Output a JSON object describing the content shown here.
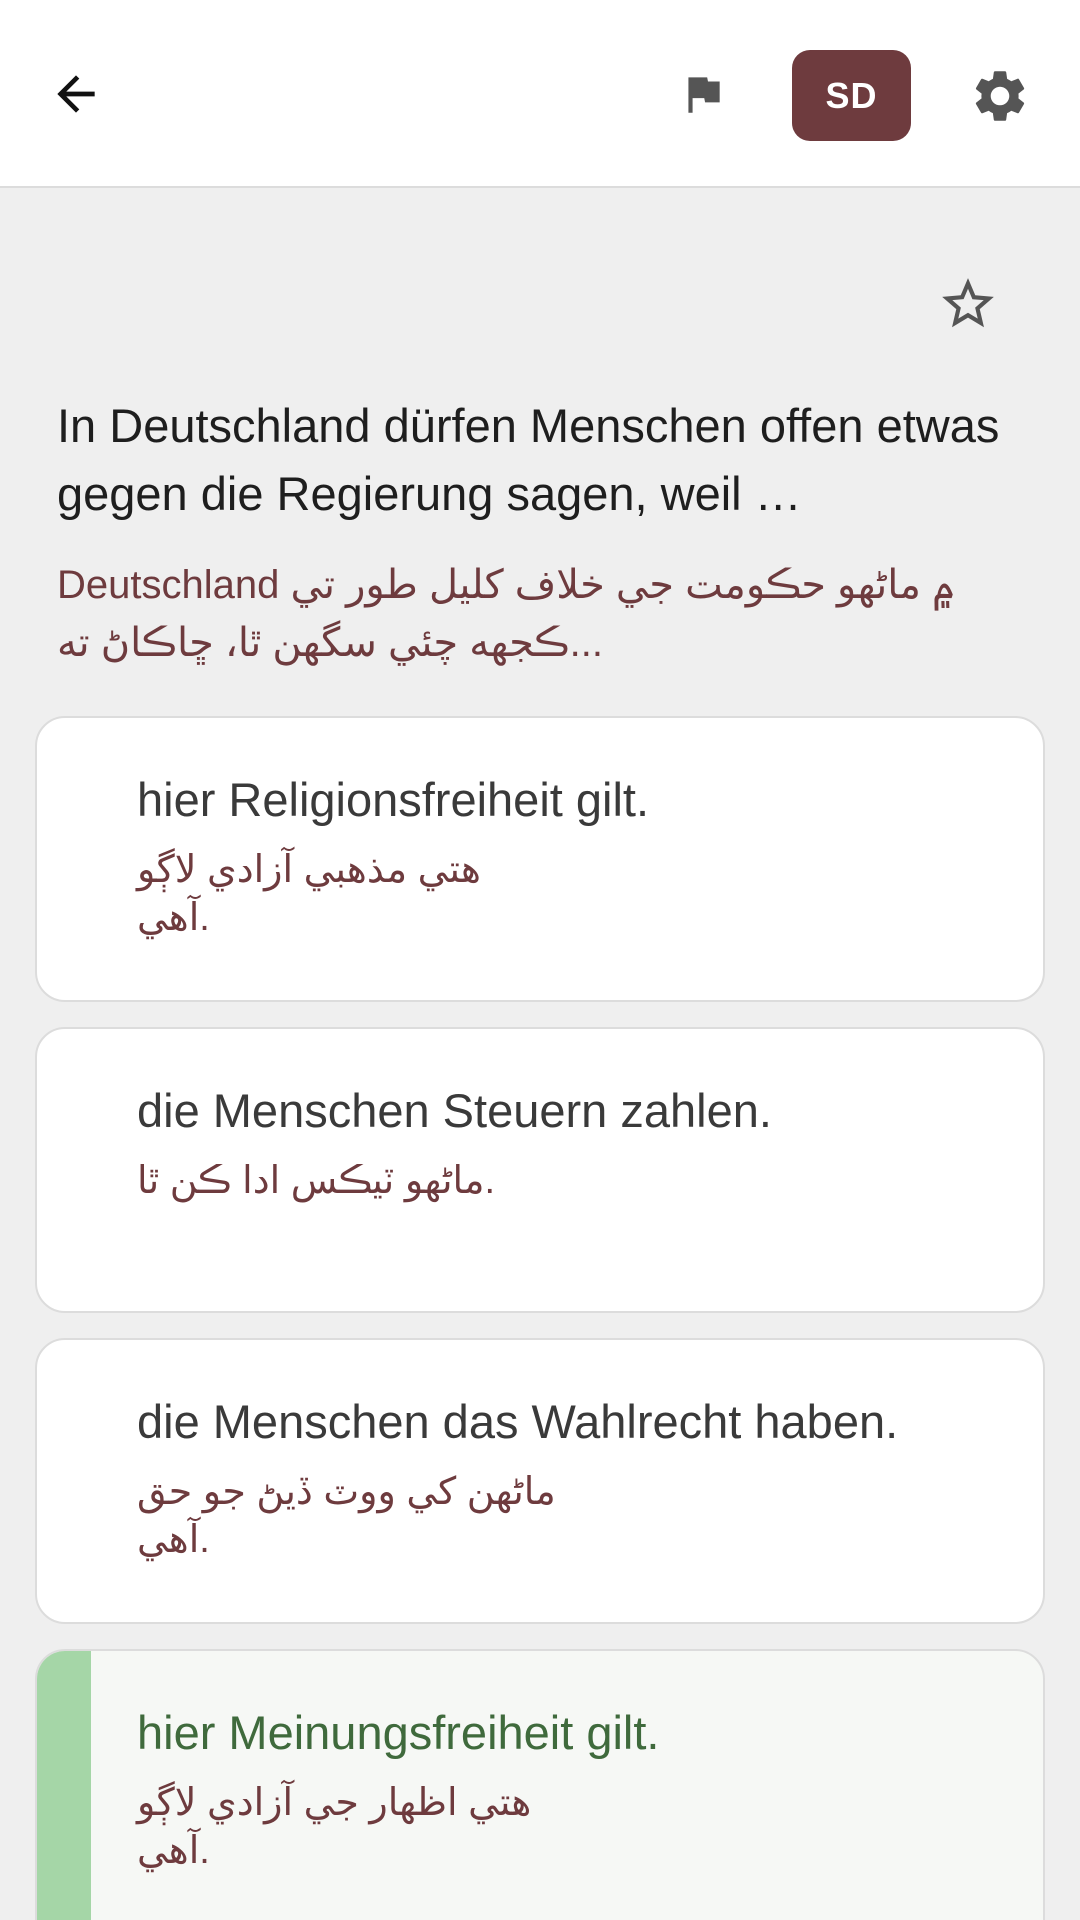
{
  "header": {
    "language_badge": "SD"
  },
  "question": {
    "text": "In Deutschland dürfen Menschen offen etwas gegen die Regierung sagen, weil …",
    "translation": "Deutschland ۾ ماڻهو حڪومت جي خلاف کليل طور تي ڪجهه چئي سگهن ٿا، ڇاڪاڻ ته..."
  },
  "answers": [
    {
      "text": "hier Religionsfreiheit gilt.",
      "translation": "هتي مذهبي آزادي لاڳو آهي.",
      "correct": false
    },
    {
      "text": "die Menschen Steuern zahlen.",
      "translation": "ماڻهو ٽيڪس ادا ڪن ٿا.",
      "correct": false
    },
    {
      "text": "die Menschen das Wahlrecht haben.",
      "translation": "ماڻهن کي ووٽ ڏيڻ جو حق آهي.",
      "correct": false
    },
    {
      "text": "hier Meinungsfreiheit gilt.",
      "translation": "هتي اظهار جي آزادي لاڳو آهي.",
      "correct": true
    }
  ],
  "colors": {
    "accent": "#6e3b3e",
    "correct_bar": "#a5d6a7",
    "correct_text": "#3f6a3c",
    "background": "#efefef"
  },
  "icons": {
    "back": "arrow-left-icon",
    "flag": "flag-icon",
    "settings": "gear-icon",
    "favorite": "star-outline-icon"
  }
}
